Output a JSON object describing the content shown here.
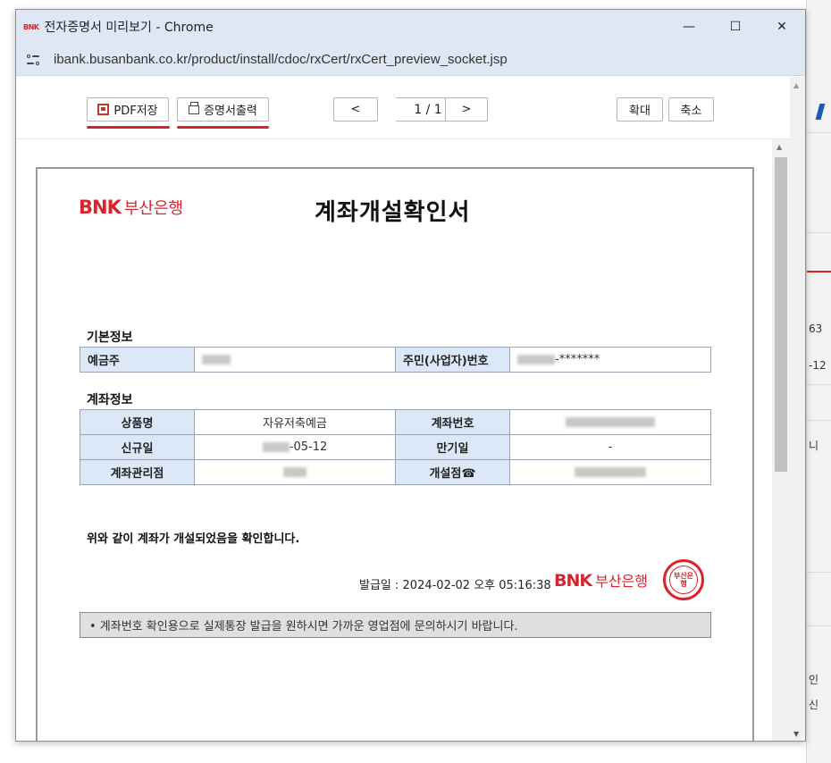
{
  "window": {
    "title": "전자증명서 미리보기 - Chrome",
    "logo_text": "BNK",
    "url": "ibank.busanbank.co.kr/product/install/cdoc/rxCert/rxCert_preview_socket.jsp",
    "minimize_glyph": "—",
    "maximize_glyph": "☐",
    "close_glyph": "✕"
  },
  "toolbar": {
    "pdf_label": "PDF저장",
    "print_label": "증명서출력",
    "prev_glyph": "<",
    "next_glyph": ">",
    "page_indicator": "1 / 1",
    "zoom_in_label": "확대",
    "zoom_out_label": "축소"
  },
  "document": {
    "logo_bnk": "BNK",
    "logo_bank": "부산은행",
    "title": "계좌개설확인서",
    "basic_section": "기본정보",
    "basic": {
      "depositor_label": "예금주",
      "id_label": "주민(사업자)번호",
      "id_suffix": "-*******"
    },
    "account_section": "계좌정보",
    "account": {
      "product_label": "상품명",
      "product_value": "자유저축예금",
      "account_no_label": "계좌번호",
      "open_date_label": "신규일",
      "open_date_suffix": "-05-12",
      "maturity_label": "만기일",
      "maturity_value": "-",
      "branch_label": "계좌관리점",
      "open_branch_label": "개설점☎"
    },
    "confirm_text": "위와 같이 계좌가 개설되었음을 확인합니다.",
    "issue_text": "발급일 : 2024-02-02 오후 05:16:38",
    "seal_text": "부산은행",
    "notice": "• 계좌번호 확인용으로 실제통장 발급을 원하시면 가까운 영업점에 문의하시기 바랍니다."
  },
  "background": {
    "frag1": "63",
    "frag2": "-12",
    "frag3": "니",
    "frag4": "인",
    "frag5": "신"
  },
  "colors": {
    "brand_red": "#d9232d",
    "label_blue": "#dce8f7",
    "chrome_bar": "#dfe7f4"
  }
}
